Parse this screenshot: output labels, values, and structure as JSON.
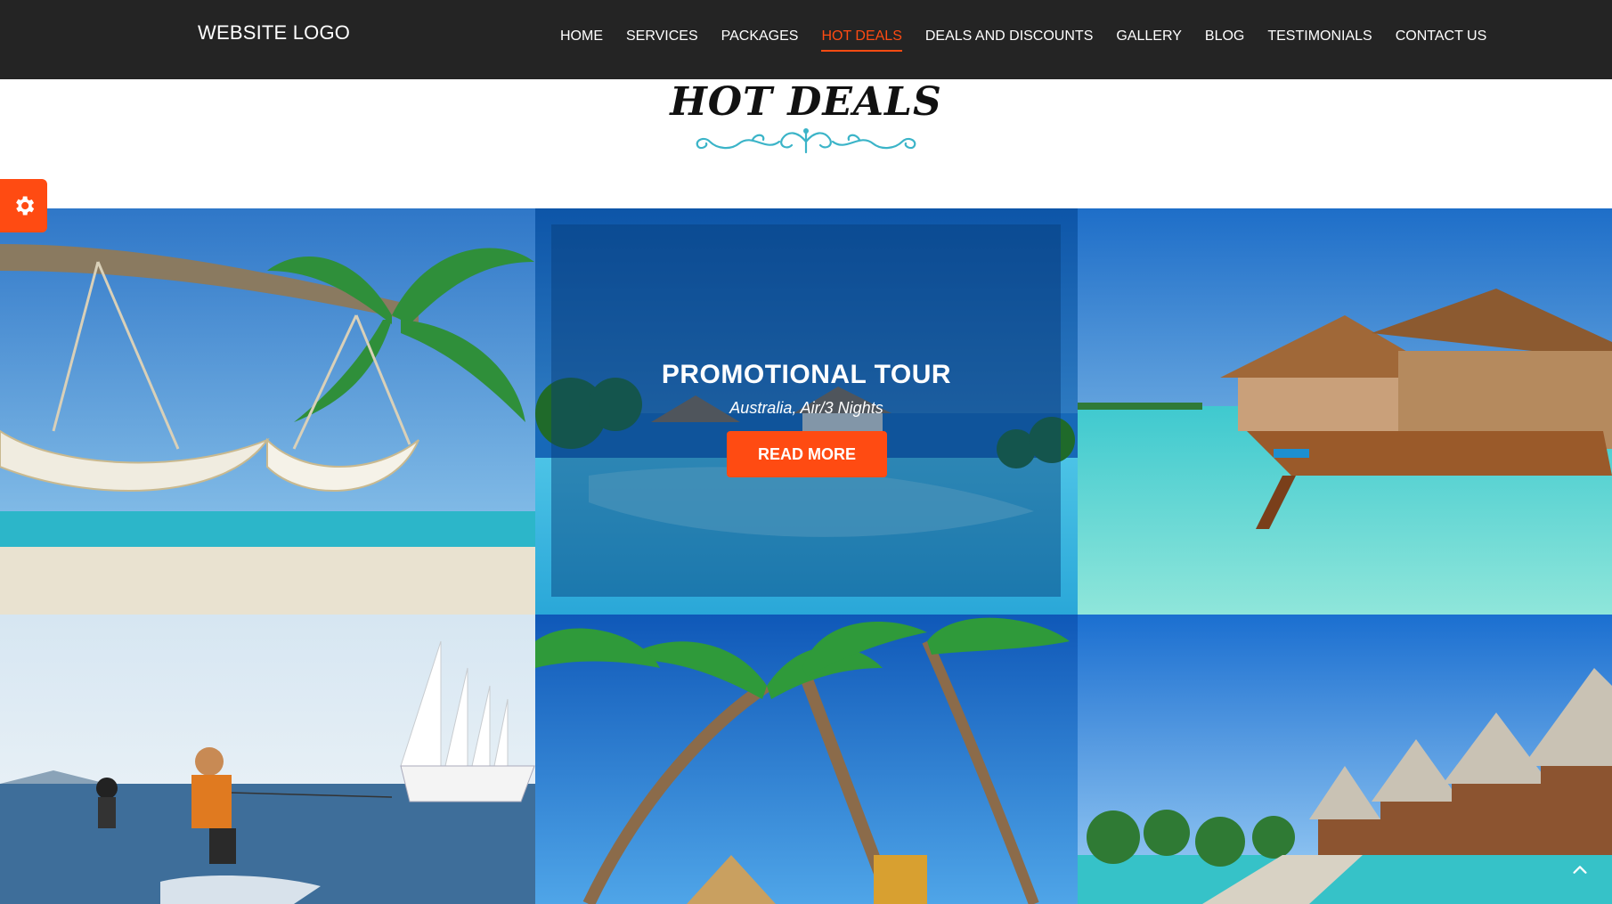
{
  "header": {
    "logo_text": "WEBSITE LOGO",
    "nav": [
      {
        "label": "HOME"
      },
      {
        "label": "SERVICES"
      },
      {
        "label": "PACKAGES"
      },
      {
        "label": "HOT DEALS",
        "active": true
      },
      {
        "label": "DEALS AND DISCOUNTS"
      },
      {
        "label": "GALLERY"
      },
      {
        "label": "BLOG"
      },
      {
        "label": "TESTIMONIALS"
      },
      {
        "label": "CONTACT US"
      }
    ]
  },
  "section": {
    "title": "HOT DEALS"
  },
  "promo": {
    "title": "PROMOTIONAL TOUR",
    "subtitle": "Australia, Air/3 Nights",
    "button_label": "READ MORE"
  },
  "gallery": [
    {
      "icon": "hammock-beach-photo"
    },
    {
      "icon": "infinity-pool-photo"
    },
    {
      "icon": "overwater-villa-photo"
    },
    {
      "icon": "waterski-sailboat-photo"
    },
    {
      "icon": "palm-trees-photo"
    },
    {
      "icon": "overwater-bungalows-photo"
    }
  ],
  "colors": {
    "accent": "#ff4b12",
    "header_bg": "#242424",
    "ornament": "#3bb4c8"
  },
  "icons": {
    "settings": "gear-icon",
    "scroll_top": "chevron-up-icon"
  }
}
